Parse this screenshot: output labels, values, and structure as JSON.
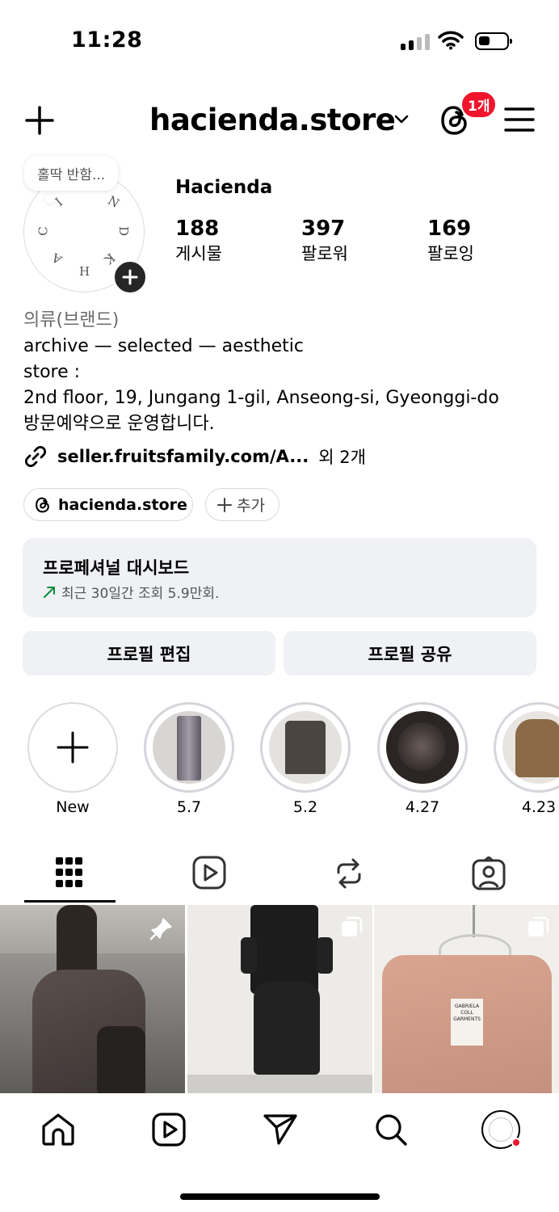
{
  "status": {
    "time": "11:28"
  },
  "header": {
    "username": "hacienda.store",
    "notification_count": "1개"
  },
  "profile": {
    "note": "홀딱 반함...",
    "avatar_letters": [
      "N",
      "D",
      "K",
      "H",
      "A",
      "C",
      "I"
    ],
    "name": "Hacienda",
    "stats": [
      {
        "value": "188",
        "label": "게시물"
      },
      {
        "value": "397",
        "label": "팔로워"
      },
      {
        "value": "169",
        "label": "팔로잉"
      }
    ],
    "category": "의류(브랜드)",
    "bio_lines": [
      "archive — selected — aesthetic",
      "store :",
      "2nd floor, 19, Jungang 1-gil, Anseong-si, Gyeonggi-do",
      "방문예약으로 운영합니다."
    ],
    "link": "seller.fruitsfamily.com/A...",
    "link_more": "외 2개"
  },
  "pills": {
    "threads": "hacienda.store",
    "add": "추가"
  },
  "dashboard": {
    "title": "프로페셔널 대시보드",
    "subtitle": "최근 30일간 조회 5.9만회."
  },
  "buttons": {
    "edit": "프로필 편집",
    "share": "프로필 공유"
  },
  "highlights": [
    {
      "label": "New"
    },
    {
      "label": "5.7"
    },
    {
      "label": "5.2"
    },
    {
      "label": "4.27"
    },
    {
      "label": "4.23"
    }
  ],
  "tabs": [
    "grid",
    "reels",
    "reposts",
    "tagged"
  ],
  "grid_posts": [
    {
      "label": "photo of person wearing dark bomber jacket and backpack on street",
      "pinned": true
    },
    {
      "label": "photo of black outfit with wide cropped trousers",
      "multi": true
    },
    {
      "label": "photo of pink shirt on hanger with brand label",
      "label_text": "GABRIELA COLL GARMENTS",
      "multi": true
    }
  ],
  "colors": {
    "accent": "#f0142c",
    "surface": "#eff1f5",
    "trend_green": "#0f8a3c"
  }
}
